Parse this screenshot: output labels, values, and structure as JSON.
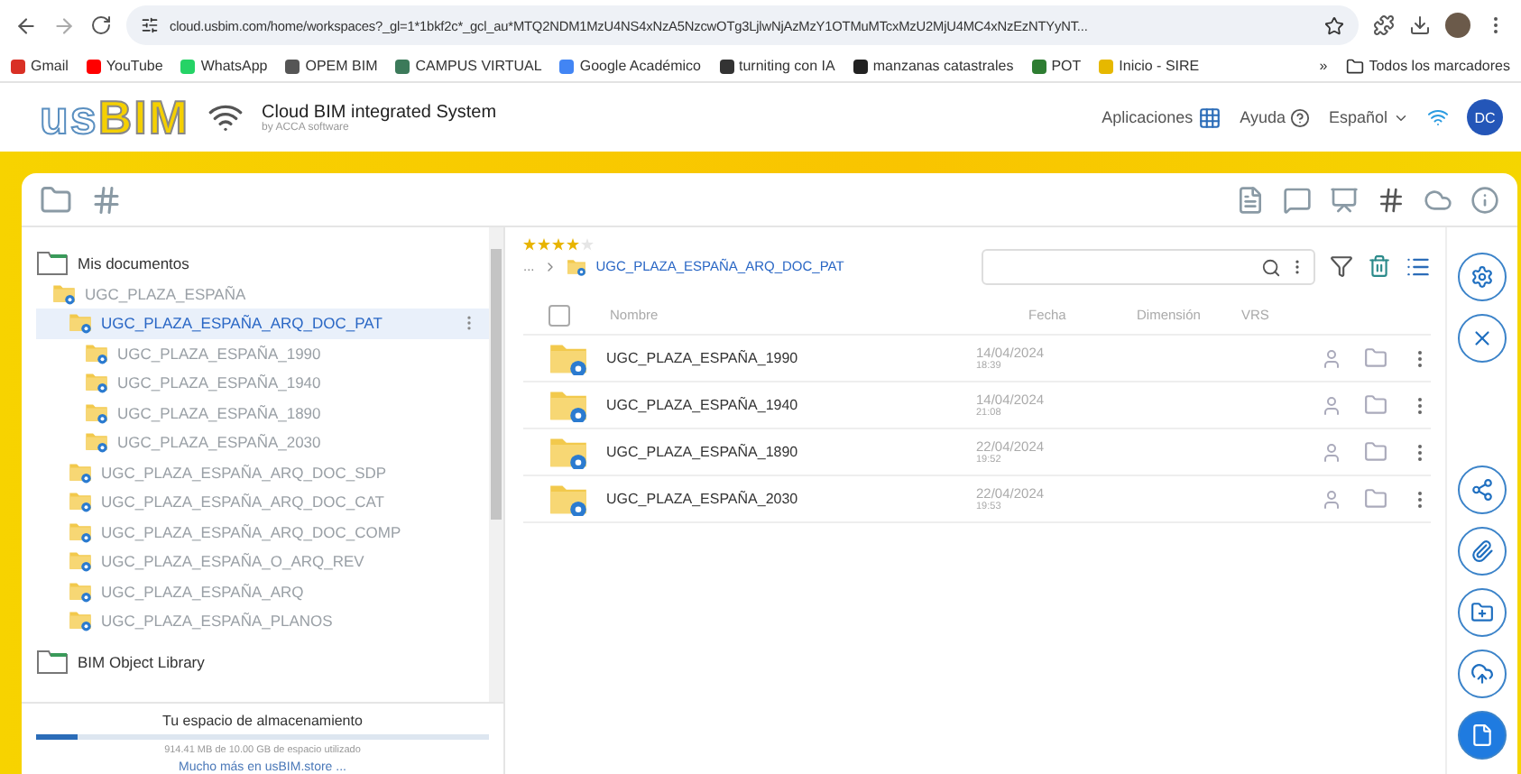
{
  "browser": {
    "url": "cloud.usbim.com/home/workspaces?_gl=1*1bkf2c*_gcl_au*MTQ2NDM1MzU4NS4xNzA5NzcwOTg3LjlwNjAzMzY1OTMuMTcxMzU2MjU4MC4xNzEzNTYyNT...",
    "bookmarks": [
      {
        "label": "Gmail",
        "color": "#d93025"
      },
      {
        "label": "YouTube",
        "color": "#ff0000"
      },
      {
        "label": "WhatsApp",
        "color": "#25d366"
      },
      {
        "label": "OPEM BIM",
        "color": "#555555"
      },
      {
        "label": "CAMPUS VIRTUAL",
        "color": "#3c7a5a"
      },
      {
        "label": "Google Académico",
        "color": "#4285f4"
      },
      {
        "label": "turniting con IA",
        "color": "#333333"
      },
      {
        "label": "manzanas catastrales",
        "color": "#222222"
      },
      {
        "label": "POT",
        "color": "#2e7d32"
      },
      {
        "label": "Inicio - SIRE",
        "color": "#e6b800"
      }
    ],
    "overflow": "»",
    "all_bookmarks": "Todos los marcadores"
  },
  "app": {
    "logo_a": "us",
    "logo_b": "BIM",
    "title": "Cloud BIM integrated System",
    "subtitle": "by ACCA software",
    "menu": [
      "Aplicaciones",
      "Ayuda",
      "Español"
    ],
    "avatar": "DC"
  },
  "tree": [
    {
      "label": "Mis documentos",
      "kind": "root",
      "selected": false,
      "children": [
        {
          "label": "UGC_PLAZA_ESPAÑA",
          "kind": "folder",
          "selected": false,
          "children": [
            {
              "label": "UGC_PLAZA_ESPAÑA_ARQ_DOC_PAT",
              "kind": "folder",
              "selected": true,
              "children": [
                {
                  "label": "UGC_PLAZA_ESPAÑA_1990",
                  "kind": "folder",
                  "selected": false
                },
                {
                  "label": "UGC_PLAZA_ESPAÑA_1940",
                  "kind": "folder",
                  "selected": false
                },
                {
                  "label": "UGC_PLAZA_ESPAÑA_1890",
                  "kind": "folder",
                  "selected": false
                },
                {
                  "label": "UGC_PLAZA_ESPAÑA_2030",
                  "kind": "folder",
                  "selected": false
                }
              ]
            },
            {
              "label": "UGC_PLAZA_ESPAÑA_ARQ_DOC_SDP",
              "kind": "folder",
              "selected": false
            },
            {
              "label": "UGC_PLAZA_ESPAÑA_ARQ_DOC_CAT",
              "kind": "folder",
              "selected": false
            },
            {
              "label": "UGC_PLAZA_ESPAÑA_ARQ_DOC_COMP",
              "kind": "folder",
              "selected": false
            },
            {
              "label": "UGC_PLAZA_ESPAÑA_O_ARQ_REV",
              "kind": "folder",
              "selected": false
            },
            {
              "label": "UGC_PLAZA_ESPAÑA_ARQ",
              "kind": "folder",
              "selected": false
            },
            {
              "label": "UGC_PLAZA_ESPAÑA_PLANOS",
              "kind": "folder",
              "selected": false
            }
          ]
        }
      ]
    },
    {
      "label": "BIM Object Library",
      "kind": "root",
      "selected": false
    }
  ],
  "storage": {
    "title": "Tu espacio de almacenamiento",
    "level": 0.09,
    "usage": "914.41 MB de 10.00 GB de espacio utilizado",
    "link": "Mucho más en usBIM.store ..."
  },
  "rating": {
    "stars": 4
  },
  "breadcrumb": {
    "ellipsis": "...",
    "current": "UGC_PLAZA_ESPAÑA_ARQ_DOC_PAT"
  },
  "table": {
    "checked": false,
    "columns": [
      "Nombre",
      "Fecha",
      "Dimensión",
      "VRS"
    ],
    "rows": [
      {
        "name": "UGC_PLAZA_ESPAÑA_1990",
        "date": "14/04/2024",
        "time": "18:39"
      },
      {
        "name": "UGC_PLAZA_ESPAÑA_1940",
        "date": "14/04/2024",
        "time": "21:08"
      },
      {
        "name": "UGC_PLAZA_ESPAÑA_1890",
        "date": "22/04/2024",
        "time": "19:52"
      },
      {
        "name": "UGC_PLAZA_ESPAÑA_2030",
        "date": "22/04/2024",
        "time": "19:53"
      }
    ]
  }
}
